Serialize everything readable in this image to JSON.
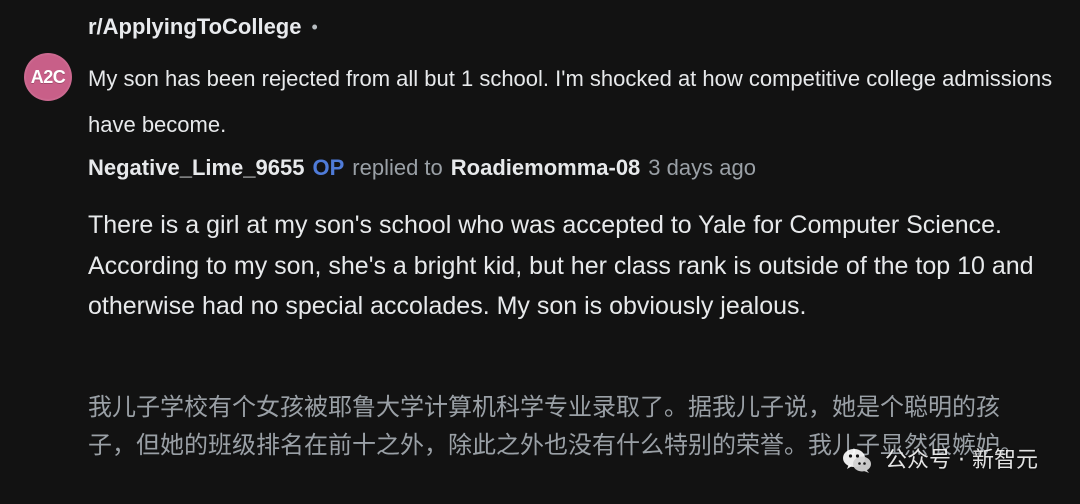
{
  "subreddit": {
    "name": "r/ApplyingToCollege",
    "separator": "•"
  },
  "avatar": {
    "label": "A2C",
    "color": "#c85f88"
  },
  "post": {
    "title": "My son has been rejected from all but 1 school. I'm shocked at how competitive college admissions have become."
  },
  "comment": {
    "author": "Negative_Lime_9655",
    "op_badge": "OP",
    "replied_text": "replied to",
    "reply_target": "Roadiemomma-08",
    "time": "3 days ago",
    "body_en": "There is a girl at my son's school who was accepted to Yale for Computer Science. According to my son, she's a bright kid, but her class rank is outside of the top 10 and otherwise had no special accolades. My son is obviously jealous.",
    "body_zh": "我儿子学校有个女孩被耶鲁大学计算机科学专业录取了。据我儿子说，她是个聪明的孩子，但她的班级排名在前十之外，除此之外也没有什么特别的荣誉。我儿子显然很嫉妒。"
  },
  "watermark": {
    "icon": "wechat-icon",
    "text": "公众号 · 新智元"
  },
  "colors": {
    "background": "#121212",
    "op_badge": "#4f7bd8",
    "muted_text": "#9aa0a6"
  }
}
